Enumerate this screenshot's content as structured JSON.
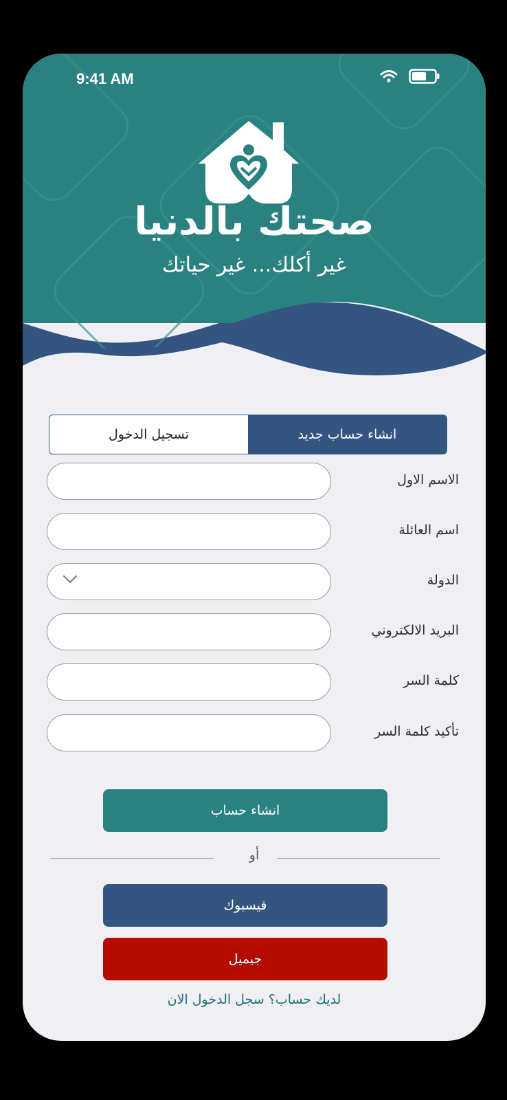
{
  "status_bar": {
    "time": "9:41 AM"
  },
  "brand": {
    "title": "صحتك بالدنيا",
    "tagline": "غير أكلك... غير حياتك"
  },
  "tabs": [
    {
      "label": "انشاء حساب جديد",
      "active": true
    },
    {
      "label": "تسجيل الدخول",
      "active": false
    }
  ],
  "form": {
    "fields": [
      {
        "label": "الاسم الاول",
        "value": ""
      },
      {
        "label": "اسم العائلة",
        "value": ""
      },
      {
        "label": "الدولة",
        "value": ""
      },
      {
        "label": "البريد الالكتروني",
        "value": ""
      },
      {
        "label": "كلمة السر",
        "value": ""
      },
      {
        "label": "تأكيد كلمة السر",
        "value": ""
      }
    ]
  },
  "buttons": {
    "create_account": "انشاء حساب",
    "facebook": "فيسبوك",
    "gmail": "جيميل"
  },
  "divider": {
    "text": "أو"
  },
  "footer": {
    "login_prompt": "لديك حساب؟ سجل الدخول الان"
  },
  "colors": {
    "teal": "#2a8280",
    "navy": "#34557f",
    "red": "#b50c00",
    "background": "#f0f0f4"
  },
  "icons": [
    "wifi-icon",
    "battery-icon",
    "house-heart-logo-icon",
    "chevron-down-icon"
  ]
}
